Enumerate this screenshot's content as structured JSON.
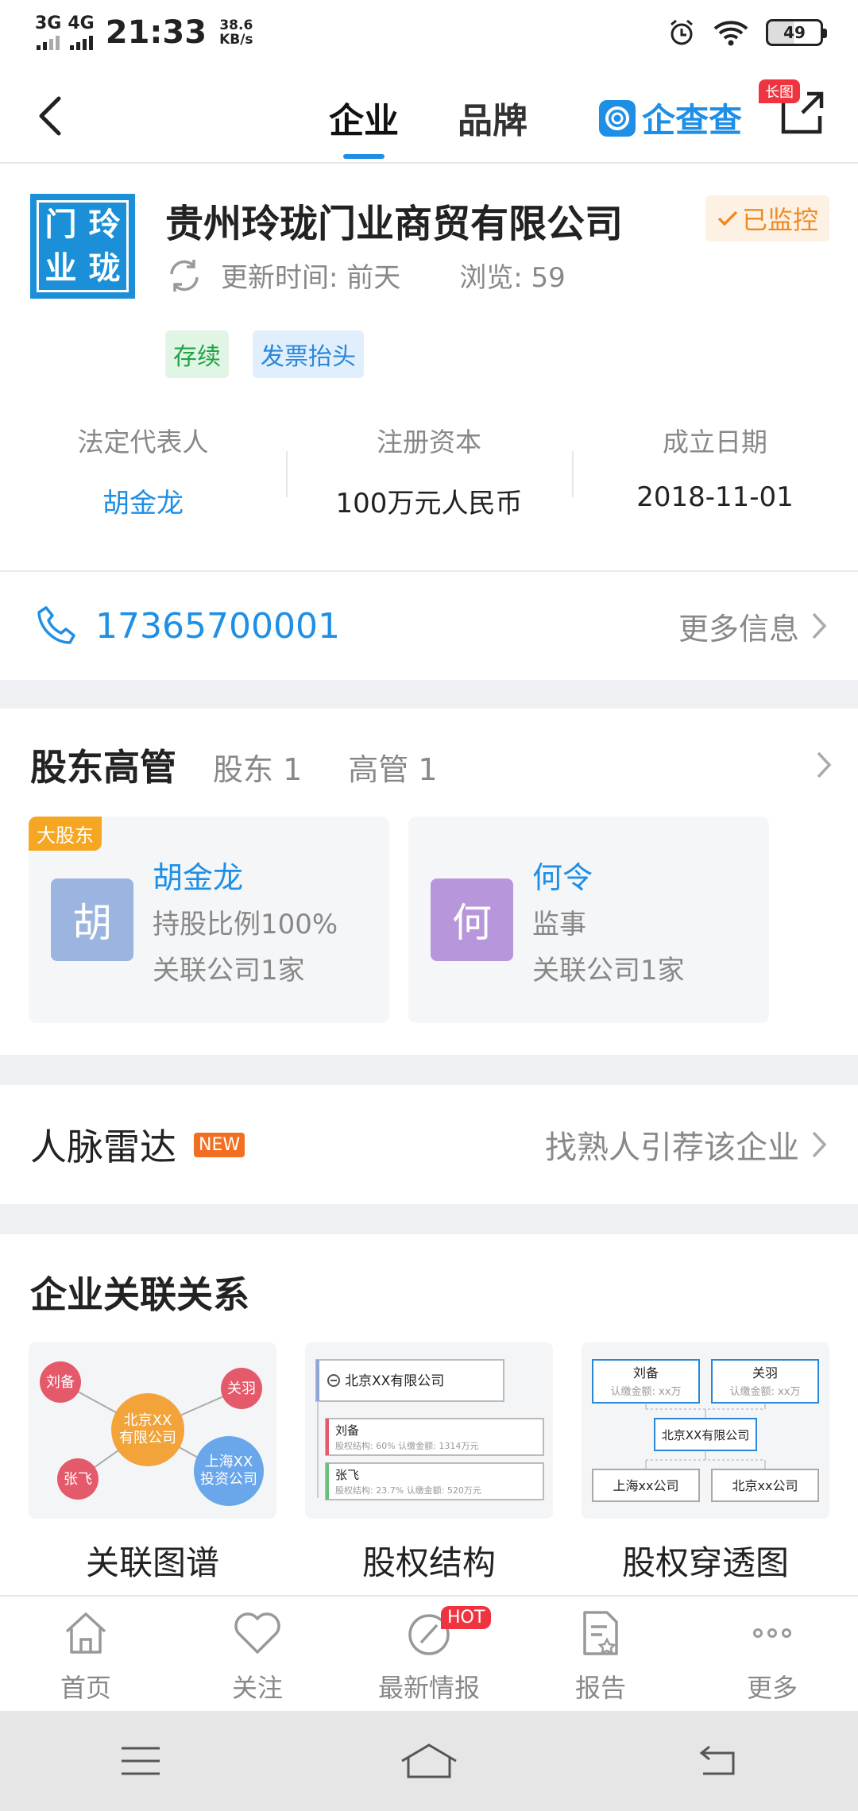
{
  "status_bar": {
    "net1": "3G",
    "net2": "4G",
    "time": "21:33",
    "speed_value": "38.6",
    "speed_unit": "KB/s",
    "battery": "49"
  },
  "nav": {
    "tab_company": "企业",
    "tab_brand": "品牌",
    "brand_name": "企查查",
    "long_image_badge": "长图"
  },
  "company": {
    "logo_chars": [
      "门",
      "玲",
      "业",
      "珑"
    ],
    "name": "贵州玲珑门业商贸有限公司",
    "monitor_label": "已监控",
    "update_label": "更新时间: 前天",
    "views_label": "浏览: 59",
    "tags": [
      "存续",
      "发票抬头"
    ]
  },
  "facts": [
    {
      "label": "法定代表人",
      "value": "胡金龙"
    },
    {
      "label": "注册资本",
      "value": "100万元人民币"
    },
    {
      "label": "成立日期",
      "value": "2018-11-01"
    }
  ],
  "contact": {
    "phone": "17365700001",
    "more_label": "更多信息"
  },
  "shareholders": {
    "title": "股东高管",
    "shareholder_count": "股东 1",
    "executive_count": "高管 1",
    "cards": [
      {
        "badge": "大股东",
        "avatar": "胡",
        "name": "胡金龙",
        "line1": "持股比例100%",
        "line2": "关联公司1家",
        "color": "#9bb5e0"
      },
      {
        "badge": "",
        "avatar": "何",
        "name": "何令",
        "line1": "监事",
        "line2": "关联公司1家",
        "color": "#b796db"
      }
    ]
  },
  "radar": {
    "title": "人脉雷达",
    "badge": "NEW",
    "link": "找熟人引荐该企业"
  },
  "relations": {
    "title": "企业关联关系",
    "items": [
      "关联图谱",
      "股权结构",
      "股权穿透图"
    ],
    "graph": {
      "center": "北京XX\n有限公司",
      "n1": "刘备",
      "n2": "关羽",
      "n3": "张飞",
      "n4": "上海XX\n投资公司"
    },
    "structure": {
      "company": "北京XX有限公司",
      "p1": "刘备",
      "p1_detail": "股权结构: 60%  认缴金额: 1314万元",
      "p2": "张飞",
      "p2_detail": "股权结构: 23.7%  认缴金额: 520万元"
    },
    "penetration": {
      "a": "刘备",
      "a_sub": "认缴金额: xx万",
      "b": "关羽",
      "b_sub": "认缴金额: xx万",
      "center": "北京XX有限公司",
      "c": "上海xx公司",
      "d": "北京xx公司"
    }
  },
  "tabbar": {
    "items": [
      "首页",
      "关注",
      "最新情报",
      "报告",
      "更多"
    ],
    "hot_badge": "HOT"
  },
  "colors": {
    "accent": "#1f8fe5",
    "monitor": "#f08a24",
    "hot": "#f0343f"
  }
}
